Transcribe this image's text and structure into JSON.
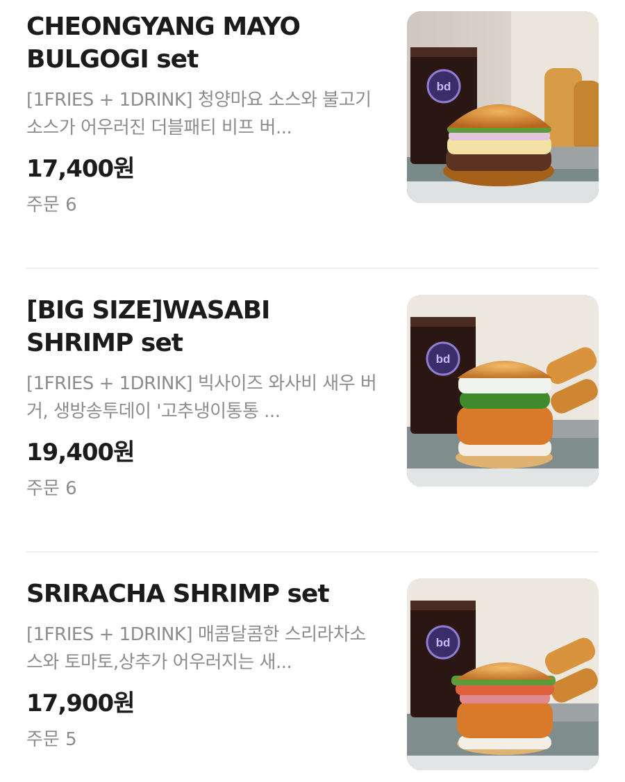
{
  "menu": {
    "items": [
      {
        "name_line1": "CHEONGYANG MAYO",
        "name_line2": "BULGOGI set",
        "description": "[1FRIES + 1DRINK] 청양마요 소스와 불고기 소스가 어우러진 더블패티 비프 버...",
        "price": "17,400원",
        "orders": "주문 6",
        "image": "cheongyang-mayo-bulgogi-burger-set-photo"
      },
      {
        "name_line1": "[BIG SIZE]WASABI",
        "name_line2": "SHRIMP set",
        "description": "[1FRIES + 1DRINK] 빅사이즈 와사비 새우 버거, 생방송투데이 '고추냉이통통 ...",
        "price": "19,400원",
        "orders": "주문 6",
        "image": "wasabi-shrimp-burger-set-photo"
      },
      {
        "name_line1": "SRIRACHA SHRIMP set",
        "name_line2": "",
        "description": "[1FRIES + 1DRINK] 매콤달콤한 스리라차소스와 토마토,상추가 어우러지는 새...",
        "price": "17,900원",
        "orders": "주문 5",
        "image": "sriracha-shrimp-burger-set-photo"
      }
    ]
  },
  "photo_badge_text": "bd",
  "colors": {
    "title": "#1b1b1b",
    "secondary_text": "#8c8c8c",
    "divider": "#efefef"
  }
}
